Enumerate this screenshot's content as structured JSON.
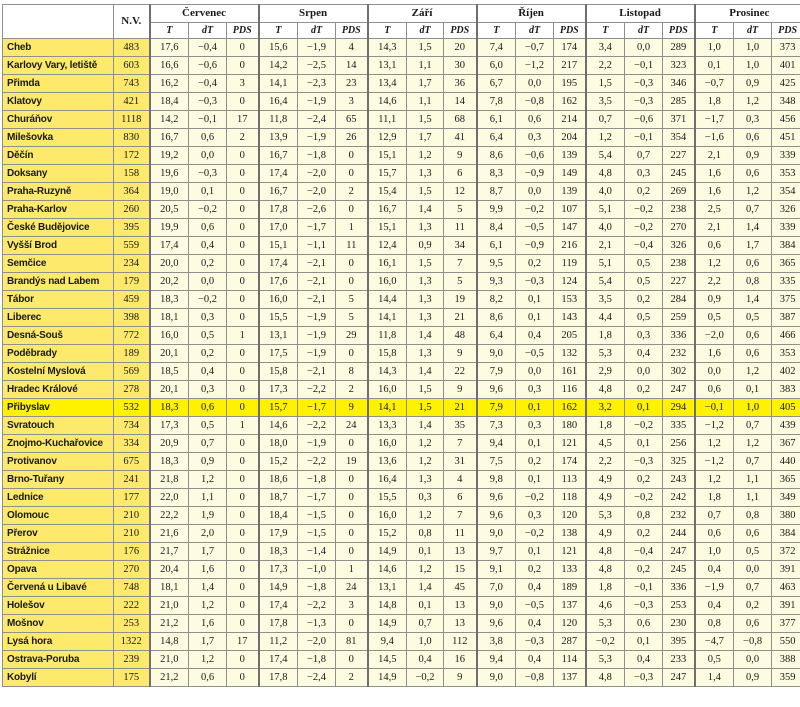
{
  "header": {
    "nv": "N.V.",
    "months": [
      "Červenec",
      "Srpen",
      "Září",
      "Říjen",
      "Listopad",
      "Prosinec"
    ],
    "sub": [
      "T",
      "dT",
      "PDS"
    ]
  },
  "highlighted": "Přibyslav",
  "rows": [
    [
      "Cheb",
      "483",
      "17,6",
      "−0,4",
      "0",
      "15,6",
      "−1,9",
      "4",
      "14,3",
      "1,5",
      "20",
      "7,4",
      "−0,7",
      "174",
      "3,4",
      "0,0",
      "289",
      "1,0",
      "1,0",
      "373"
    ],
    [
      "Karlovy Vary, letiště",
      "603",
      "16,6",
      "−0,6",
      "0",
      "14,2",
      "−2,5",
      "14",
      "13,1",
      "1,1",
      "30",
      "6,0",
      "−1,2",
      "217",
      "2,2",
      "−0,1",
      "323",
      "0,1",
      "1,0",
      "401"
    ],
    [
      "Přimda",
      "743",
      "16,2",
      "−0,4",
      "3",
      "14,1",
      "−2,3",
      "23",
      "13,4",
      "1,7",
      "36",
      "6,7",
      "0,0",
      "195",
      "1,5",
      "−0,3",
      "346",
      "−0,7",
      "0,9",
      "425"
    ],
    [
      "Klatovy",
      "421",
      "18,4",
      "−0,3",
      "0",
      "16,4",
      "−1,9",
      "3",
      "14,6",
      "1,1",
      "14",
      "7,8",
      "−0,8",
      "162",
      "3,5",
      "−0,3",
      "285",
      "1,8",
      "1,2",
      "348"
    ],
    [
      "Churáňov",
      "1118",
      "14,2",
      "−0,1",
      "17",
      "11,8",
      "−2,4",
      "65",
      "11,1",
      "1,5",
      "68",
      "6,1",
      "0,6",
      "214",
      "0,7",
      "−0,6",
      "371",
      "−1,7",
      "0,3",
      "456"
    ],
    [
      "Milešovka",
      "830",
      "16,7",
      "0,6",
      "2",
      "13,9",
      "−1,9",
      "26",
      "12,9",
      "1,7",
      "41",
      "6,4",
      "0,3",
      "204",
      "1,2",
      "−0,1",
      "354",
      "−1,6",
      "0,6",
      "451"
    ],
    [
      "Děčín",
      "172",
      "19,2",
      "0,0",
      "0",
      "16,7",
      "−1,8",
      "0",
      "15,1",
      "1,2",
      "9",
      "8,6",
      "−0,6",
      "139",
      "5,4",
      "0,7",
      "227",
      "2,1",
      "0,9",
      "339"
    ],
    [
      "Doksany",
      "158",
      "19,6",
      "−0,3",
      "0",
      "17,4",
      "−2,0",
      "0",
      "15,7",
      "1,3",
      "6",
      "8,3",
      "−0,9",
      "149",
      "4,8",
      "0,3",
      "245",
      "1,6",
      "0,6",
      "353"
    ],
    [
      "Praha-Ruzyně",
      "364",
      "19,0",
      "0,1",
      "0",
      "16,7",
      "−2,0",
      "2",
      "15,4",
      "1,5",
      "12",
      "8,7",
      "0,0",
      "139",
      "4,0",
      "0,2",
      "269",
      "1,6",
      "1,2",
      "354"
    ],
    [
      "Praha-Karlov",
      "260",
      "20,5",
      "−0,2",
      "0",
      "17,8",
      "−2,6",
      "0",
      "16,7",
      "1,4",
      "5",
      "9,9",
      "−0,2",
      "107",
      "5,1",
      "−0,2",
      "238",
      "2,5",
      "0,7",
      "326"
    ],
    [
      "České Budějovice",
      "395",
      "19,9",
      "0,6",
      "0",
      "17,0",
      "−1,7",
      "1",
      "15,1",
      "1,3",
      "11",
      "8,4",
      "−0,5",
      "147",
      "4,0",
      "−0,2",
      "270",
      "2,1",
      "1,4",
      "339"
    ],
    [
      "Vyšší Brod",
      "559",
      "17,4",
      "0,4",
      "0",
      "15,1",
      "−1,1",
      "11",
      "12,4",
      "0,9",
      "34",
      "6,1",
      "−0,9",
      "216",
      "2,1",
      "−0,4",
      "326",
      "0,6",
      "1,7",
      "384"
    ],
    [
      "Semčice",
      "234",
      "20,0",
      "0,2",
      "0",
      "17,4",
      "−2,1",
      "0",
      "16,1",
      "1,5",
      "7",
      "9,5",
      "0,2",
      "119",
      "5,1",
      "0,5",
      "238",
      "1,2",
      "0,6",
      "365"
    ],
    [
      "Brandýs nad Labem",
      "179",
      "20,2",
      "0,0",
      "0",
      "17,6",
      "−2,1",
      "0",
      "16,0",
      "1,3",
      "5",
      "9,3",
      "−0,3",
      "124",
      "5,4",
      "0,5",
      "227",
      "2,2",
      "0,8",
      "335"
    ],
    [
      "Tábor",
      "459",
      "18,3",
      "−0,2",
      "0",
      "16,0",
      "−2,1",
      "5",
      "14,4",
      "1,3",
      "19",
      "8,2",
      "0,1",
      "153",
      "3,5",
      "0,2",
      "284",
      "0,9",
      "1,4",
      "375"
    ],
    [
      "Liberec",
      "398",
      "18,1",
      "0,3",
      "0",
      "15,5",
      "−1,9",
      "5",
      "14,1",
      "1,3",
      "21",
      "8,6",
      "0,1",
      "143",
      "4,4",
      "0,5",
      "259",
      "0,5",
      "0,5",
      "387"
    ],
    [
      "Desná-Souš",
      "772",
      "16,0",
      "0,5",
      "1",
      "13,1",
      "−1,9",
      "29",
      "11,8",
      "1,4",
      "48",
      "6,4",
      "0,4",
      "205",
      "1,8",
      "0,3",
      "336",
      "−2,0",
      "0,6",
      "466"
    ],
    [
      "Poděbrady",
      "189",
      "20,1",
      "0,2",
      "0",
      "17,5",
      "−1,9",
      "0",
      "15,8",
      "1,3",
      "9",
      "9,0",
      "−0,5",
      "132",
      "5,3",
      "0,4",
      "232",
      "1,6",
      "0,6",
      "353"
    ],
    [
      "Kostelní Myslová",
      "569",
      "18,5",
      "0,4",
      "0",
      "15,8",
      "−2,1",
      "8",
      "14,3",
      "1,4",
      "22",
      "7,9",
      "0,0",
      "161",
      "2,9",
      "0,0",
      "302",
      "0,0",
      "1,2",
      "402"
    ],
    [
      "Hradec Králové",
      "278",
      "20,1",
      "0,3",
      "0",
      "17,3",
      "−2,2",
      "2",
      "16,0",
      "1,5",
      "9",
      "9,6",
      "0,3",
      "116",
      "4,8",
      "0,2",
      "247",
      "0,6",
      "0,1",
      "383"
    ],
    [
      "Přibyslav",
      "532",
      "18,3",
      "0,6",
      "0",
      "15,7",
      "−1,7",
      "9",
      "14,1",
      "1,5",
      "21",
      "7,9",
      "0,1",
      "162",
      "3,2",
      "0,1",
      "294",
      "−0,1",
      "1,0",
      "405"
    ],
    [
      "Svratouch",
      "734",
      "17,3",
      "0,5",
      "1",
      "14,6",
      "−2,2",
      "24",
      "13,3",
      "1,4",
      "35",
      "7,3",
      "0,3",
      "180",
      "1,8",
      "−0,2",
      "335",
      "−1,2",
      "0,7",
      "439"
    ],
    [
      "Znojmo-Kuchařovice",
      "334",
      "20,9",
      "0,7",
      "0",
      "18,0",
      "−1,9",
      "0",
      "16,0",
      "1,2",
      "7",
      "9,4",
      "0,1",
      "121",
      "4,5",
      "0,1",
      "256",
      "1,2",
      "1,2",
      "367"
    ],
    [
      "Protivanov",
      "675",
      "18,3",
      "0,9",
      "0",
      "15,2",
      "−2,2",
      "19",
      "13,6",
      "1,2",
      "31",
      "7,5",
      "0,2",
      "174",
      "2,2",
      "−0,3",
      "325",
      "−1,2",
      "0,7",
      "440"
    ],
    [
      "Brno-Tuřany",
      "241",
      "21,8",
      "1,2",
      "0",
      "18,6",
      "−1,8",
      "0",
      "16,4",
      "1,3",
      "4",
      "9,8",
      "0,1",
      "113",
      "4,9",
      "0,2",
      "243",
      "1,2",
      "1,1",
      "365"
    ],
    [
      "Lednice",
      "177",
      "22,0",
      "1,1",
      "0",
      "18,7",
      "−1,7",
      "0",
      "15,5",
      "0,3",
      "6",
      "9,6",
      "−0,2",
      "118",
      "4,9",
      "−0,2",
      "242",
      "1,8",
      "1,1",
      "349"
    ],
    [
      "Olomouc",
      "210",
      "22,2",
      "1,9",
      "0",
      "18,4",
      "−1,5",
      "0",
      "16,0",
      "1,2",
      "7",
      "9,6",
      "0,3",
      "120",
      "5,3",
      "0,8",
      "232",
      "0,7",
      "0,8",
      "380"
    ],
    [
      "Přerov",
      "210",
      "21,6",
      "2,0",
      "0",
      "17,9",
      "−1,5",
      "0",
      "15,2",
      "0,8",
      "11",
      "9,0",
      "−0,2",
      "138",
      "4,9",
      "0,2",
      "244",
      "0,6",
      "0,6",
      "384"
    ],
    [
      "Strážnice",
      "176",
      "21,7",
      "1,7",
      "0",
      "18,3",
      "−1,4",
      "0",
      "14,9",
      "0,1",
      "13",
      "9,7",
      "0,1",
      "121",
      "4,8",
      "−0,4",
      "247",
      "1,0",
      "0,5",
      "372"
    ],
    [
      "Opava",
      "270",
      "20,4",
      "1,6",
      "0",
      "17,3",
      "−1,0",
      "1",
      "14,6",
      "1,2",
      "15",
      "9,1",
      "0,2",
      "133",
      "4,8",
      "0,2",
      "245",
      "0,4",
      "0,0",
      "391"
    ],
    [
      "Červená u Libavé",
      "748",
      "18,1",
      "1,4",
      "0",
      "14,9",
      "−1,8",
      "24",
      "13,1",
      "1,4",
      "45",
      "7,0",
      "0,4",
      "189",
      "1,8",
      "−0,1",
      "336",
      "−1,9",
      "0,7",
      "463"
    ],
    [
      "Holešov",
      "222",
      "21,0",
      "1,2",
      "0",
      "17,4",
      "−2,2",
      "3",
      "14,8",
      "0,1",
      "13",
      "9,0",
      "−0,5",
      "137",
      "4,6",
      "−0,3",
      "253",
      "0,4",
      "0,2",
      "391"
    ],
    [
      "Mošnov",
      "253",
      "21,2",
      "1,6",
      "0",
      "17,8",
      "−1,3",
      "0",
      "14,9",
      "0,7",
      "13",
      "9,6",
      "0,4",
      "120",
      "5,3",
      "0,6",
      "230",
      "0,8",
      "0,6",
      "377"
    ],
    [
      "Lysá hora",
      "1322",
      "14,8",
      "1,7",
      "17",
      "11,2",
      "−2,0",
      "81",
      "9,4",
      "1,0",
      "112",
      "3,8",
      "−0,3",
      "287",
      "−0,2",
      "0,1",
      "395",
      "−4,7",
      "−0,8",
      "550"
    ],
    [
      "Ostrava-Poruba",
      "239",
      "21,0",
      "1,2",
      "0",
      "17,4",
      "−1,8",
      "0",
      "14,5",
      "0,4",
      "16",
      "9,4",
      "0,4",
      "114",
      "5,3",
      "0,4",
      "233",
      "0,5",
      "0,0",
      "388"
    ],
    [
      "Kobylí",
      "175",
      "21,2",
      "0,6",
      "0",
      "17,8",
      "−2,4",
      "2",
      "14,9",
      "−0,2",
      "9",
      "9,0",
      "−0,8",
      "137",
      "4,8",
      "−0,3",
      "247",
      "1,4",
      "0,9",
      "359"
    ]
  ]
}
